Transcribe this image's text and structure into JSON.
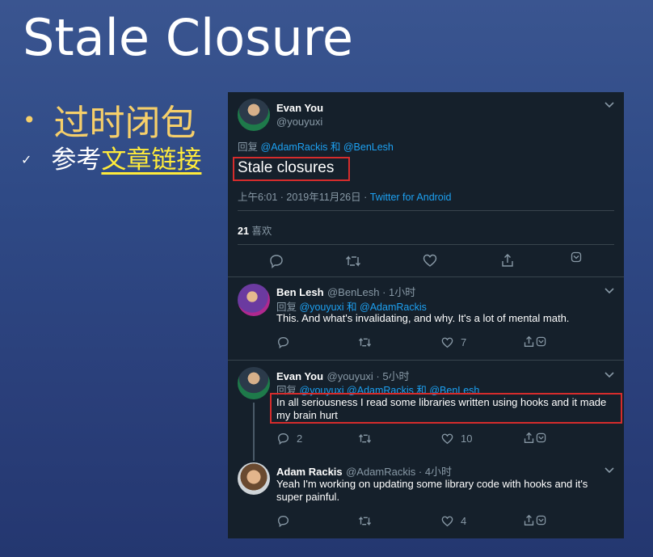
{
  "slide": {
    "title": "Stale Closure",
    "bullet_main": "过时闭包",
    "bullet_sub_prefix": "参考",
    "bullet_sub_link": "文章链接"
  },
  "main_tweet": {
    "author_name": "Evan You",
    "author_handle": "@youyuxi",
    "reply_prefix": "回复",
    "reply_user1": "@AdamRackis",
    "reply_and": "和",
    "reply_user2": "@BenLesh",
    "text": "Stale closures",
    "time": "上午6:01 · 2019年11月26日 ·",
    "source": "Twitter for Android",
    "likes_count": "21",
    "likes_label": "喜欢"
  },
  "replies": [
    {
      "name": "Ben Lesh",
      "handle": "@BenLesh · 1小时",
      "reply_prefix": "回复",
      "reply_to": "@youyuxi 和 @AdamRackis",
      "text": "This. And what's invalidating, and why. It's a lot of mental math.",
      "reply_count": "",
      "like_count": "7"
    },
    {
      "name": "Evan You",
      "handle": "@youyuxi · 5小时",
      "reply_prefix": "回复",
      "reply_to": "@youyuxi @AdamRackis 和 @BenLesh",
      "text_line1": "In all seriousness I read some libraries written using hooks and it made",
      "text_line2": "my brain hurt",
      "reply_count": "2",
      "like_count": "10"
    },
    {
      "name": "Adam Rackis",
      "handle": "@AdamRackis · 4小时",
      "text_line1": "Yeah I'm working on updating some library code with hooks and it's",
      "text_line2": "super painful.",
      "like_count": "4"
    }
  ],
  "colors": {
    "panel_bg": "#15202b",
    "accent_blue": "#1da1f2",
    "highlight_red": "#d62c2c",
    "bullet_gold": "#f6cf6a",
    "link_yellow": "#ffeb3b"
  },
  "icons": [
    "reply-icon",
    "retweet-icon",
    "like-icon",
    "share-icon",
    "chevron-down-icon",
    "bookmark-icon"
  ]
}
